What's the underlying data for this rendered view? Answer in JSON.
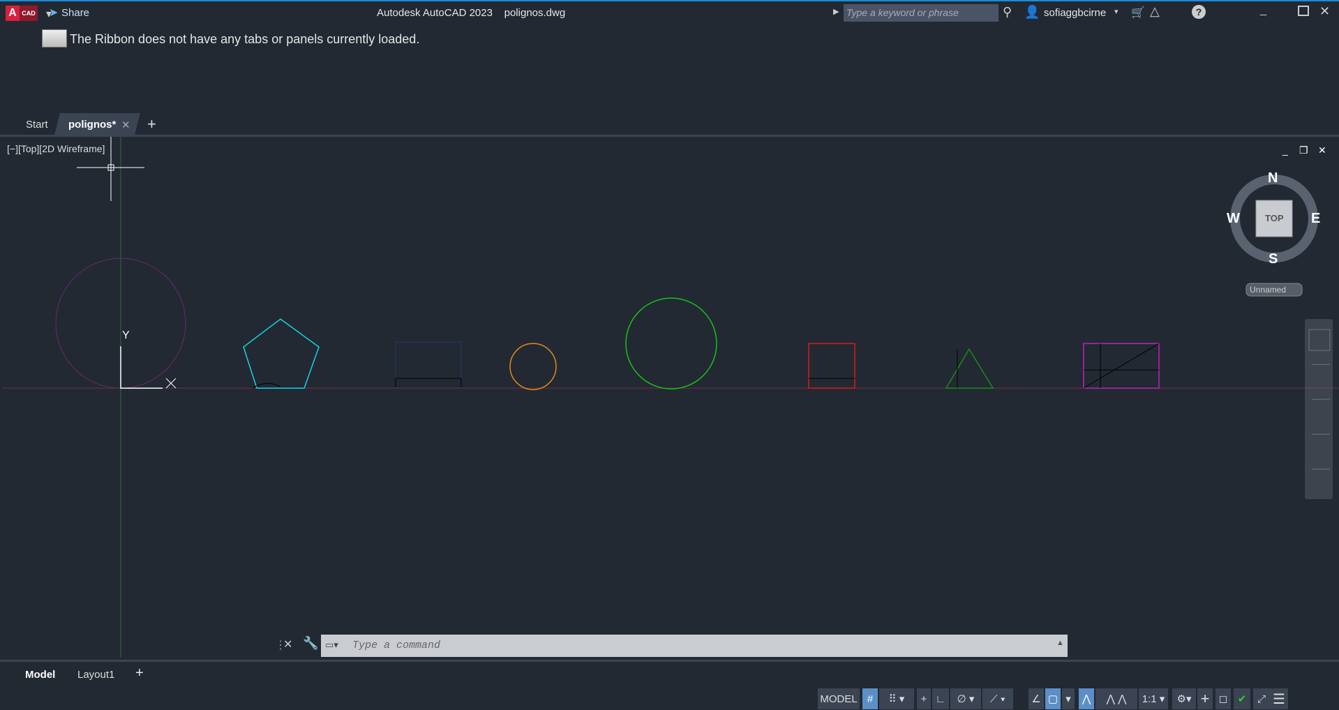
{
  "titlebar": {
    "logo_a": "A",
    "logo_cad": "CAD",
    "share": "Share",
    "app_title": "Autodesk AutoCAD 2023",
    "file_name": "polignos.dwg",
    "search_placeholder": "Type a keyword or phrase",
    "user": "sofiaggbcirne"
  },
  "ribbon": {
    "message": "The Ribbon does not have any tabs or panels currently loaded."
  },
  "doc_tabs": [
    {
      "label": "Start"
    },
    {
      "label": "polignos*",
      "active": true
    }
  ],
  "viewport": {
    "label": "[−][Top][2D Wireframe]",
    "viewcube": {
      "n": "N",
      "s": "S",
      "e": "E",
      "w": "W",
      "face": "TOP",
      "ucs": "Unnamed"
    },
    "axis_y": "Y"
  },
  "command": {
    "placeholder": "Type a command"
  },
  "layout_tabs": [
    {
      "label": "Model",
      "active": true
    },
    {
      "label": "Layout1"
    }
  ],
  "status": {
    "model": "MODEL",
    "scale": "1:1"
  },
  "colors": {
    "accent": "#1a8bd8",
    "bg": "#222933",
    "active_toggle": "#5b8fc7"
  }
}
